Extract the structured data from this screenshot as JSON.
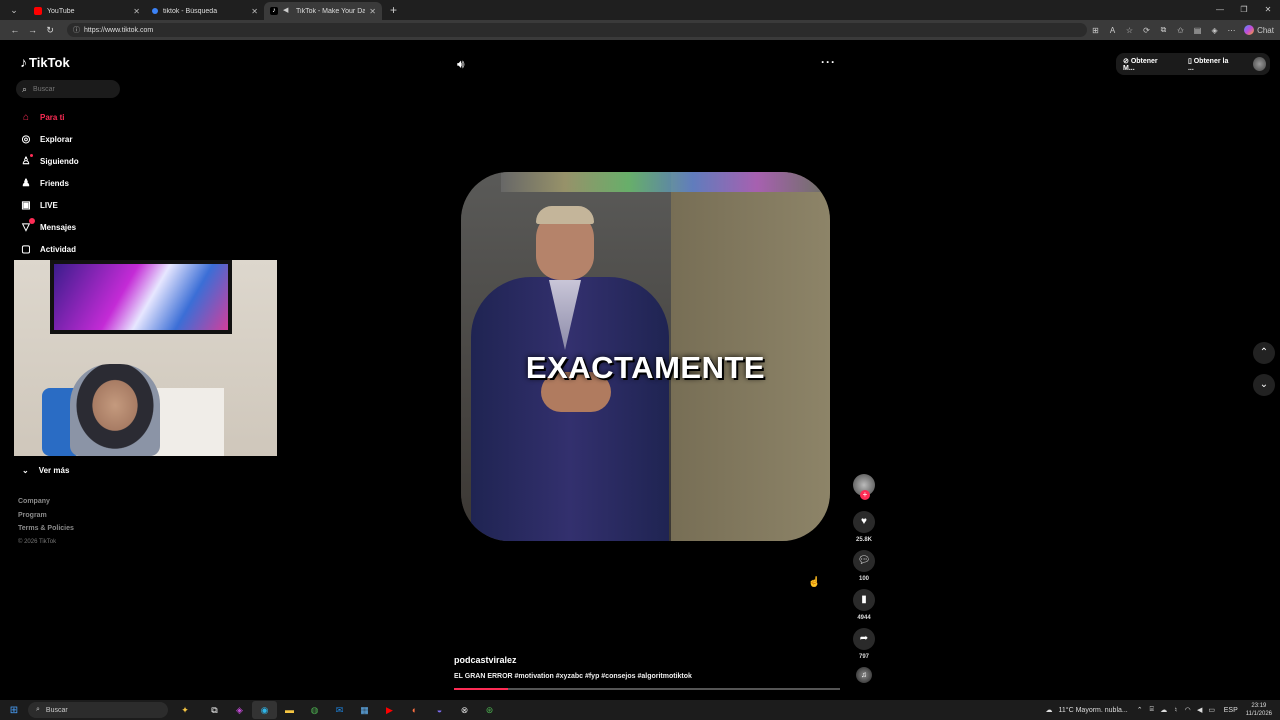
{
  "browser": {
    "tabs": [
      {
        "title": "YouTube",
        "color": "#ff0000"
      },
      {
        "title": "tiktok - Búsqueda",
        "color": "#3b82f6"
      },
      {
        "title": "TikTok - Make Your Day",
        "color": "#ffffff"
      }
    ],
    "url": "https://www.tiktok.com",
    "chat_label": "Chat"
  },
  "sidebar": {
    "logo": "TikTok",
    "search_placeholder": "Buscar",
    "items": [
      {
        "label": "Para ti",
        "icon": "⌂"
      },
      {
        "label": "Explorar",
        "icon": "◎"
      },
      {
        "label": "Siguiendo",
        "icon": "♙"
      },
      {
        "label": "Friends",
        "icon": "♟"
      },
      {
        "label": "LIVE",
        "icon": "▣"
      },
      {
        "label": "Mensajes",
        "icon": "▽"
      },
      {
        "label": "Actividad",
        "icon": "▢"
      }
    ],
    "more_label": "Ver más",
    "footer": [
      "Company",
      "Program",
      "Terms & Policies"
    ],
    "copyright": "© 2026 TikTok"
  },
  "video": {
    "caption": "EXACTAMENTE",
    "author": "podcastviralez",
    "description": "EL GRAN ERROR #motivation #xyzabc #fyp #consejos #algoritmotiktok",
    "progress": 0.14
  },
  "actions": {
    "likes": "25.8K",
    "comments": "100",
    "saves": "4944",
    "shares": "797"
  },
  "topright": {
    "get_coins": "Obtener M...",
    "get_app": "Obtener la ..."
  },
  "taskbar": {
    "search": "Buscar",
    "weather": "11°C  Mayorm. nubla...",
    "lang": "ESP",
    "time": "23:19",
    "date": "11/1/2026"
  }
}
